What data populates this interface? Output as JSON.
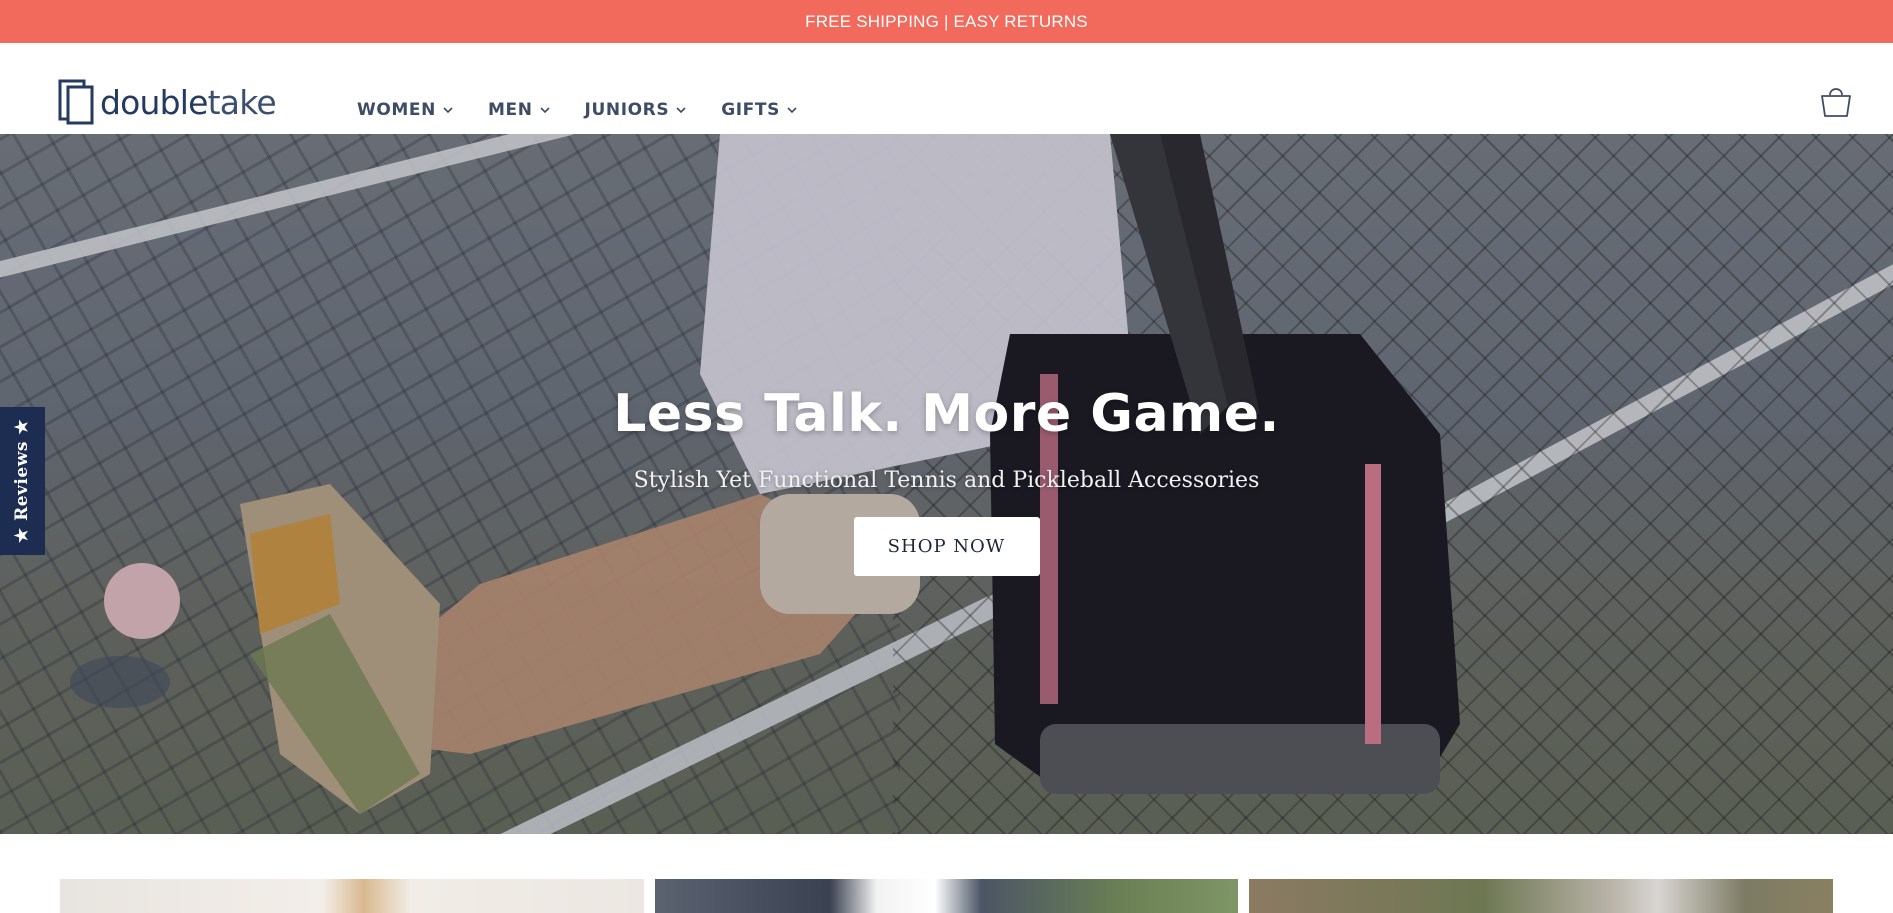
{
  "announcement": {
    "text": "FREE SHIPPING | EASY RETURNS"
  },
  "header": {
    "logo": {
      "text_bold": "double",
      "text_light": "take"
    },
    "nav": [
      {
        "label": "WOMEN"
      },
      {
        "label": "MEN"
      },
      {
        "label": "JUNIORS"
      },
      {
        "label": "GIFTS"
      }
    ],
    "cart_icon": "shopping-bag-icon"
  },
  "hero": {
    "title": "Less Talk. More Game.",
    "subtitle": "Stylish Yet Functional Tennis and Pickleball Accessories",
    "cta_label": "SHOP NOW"
  },
  "reviews_tab": {
    "label": "★ Reviews ★"
  },
  "colors": {
    "announcement_bg": "#f26a5b",
    "brand_navy": "#1d2d52",
    "nav_text": "#3f4c66"
  }
}
